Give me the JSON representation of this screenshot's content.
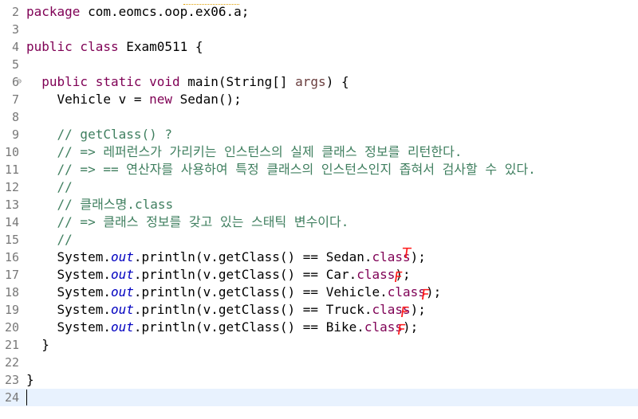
{
  "editor": {
    "lines": [
      {
        "num": "2",
        "tokens": [
          {
            "t": "package",
            "c": "kw"
          },
          {
            "t": " com.eomcs.oop.ex06.a;",
            "c": ""
          }
        ]
      },
      {
        "num": "3",
        "tokens": []
      },
      {
        "num": "4",
        "tokens": [
          {
            "t": "public class",
            "c": "kw"
          },
          {
            "t": " Exam0511 {",
            "c": ""
          }
        ]
      },
      {
        "num": "5",
        "tokens": []
      },
      {
        "num": "6",
        "fold": "⊖",
        "tokens": [
          {
            "t": "  public static void",
            "c": "kw"
          },
          {
            "t": " main(String[] ",
            "c": ""
          },
          {
            "t": "args",
            "c": "param"
          },
          {
            "t": ") {",
            "c": ""
          }
        ]
      },
      {
        "num": "7",
        "tokens": [
          {
            "t": "    Vehicle v = ",
            "c": ""
          },
          {
            "t": "new",
            "c": "kw"
          },
          {
            "t": " Sedan();",
            "c": ""
          }
        ]
      },
      {
        "num": "8",
        "tokens": []
      },
      {
        "num": "9",
        "tokens": [
          {
            "t": "    // getClass() ?",
            "c": "cm"
          }
        ]
      },
      {
        "num": "10",
        "tokens": [
          {
            "t": "    // => 레퍼런스가 가리키는 인스턴스의 실제 클래스 정보를 리턴한다.",
            "c": "cm"
          }
        ]
      },
      {
        "num": "11",
        "tokens": [
          {
            "t": "    // => == 연산자를 사용하여 특정 클래스의 인스턴스인지 좁혀서 검사할 수 있다.",
            "c": "cm"
          }
        ]
      },
      {
        "num": "12",
        "tokens": [
          {
            "t": "    //",
            "c": "cm"
          }
        ]
      },
      {
        "num": "13",
        "tokens": [
          {
            "t": "    // 클래스명.class",
            "c": "cm"
          }
        ]
      },
      {
        "num": "14",
        "tokens": [
          {
            "t": "    // => 클래스 정보를 갖고 있는 스태틱 변수이다.",
            "c": "cm"
          }
        ]
      },
      {
        "num": "15",
        "tokens": [
          {
            "t": "    //",
            "c": "cm"
          }
        ]
      },
      {
        "num": "16",
        "tokens": [
          {
            "t": "    System.",
            "c": ""
          },
          {
            "t": "out",
            "c": "fld"
          },
          {
            "t": ".println(v.getClass() == Sedan.",
            "c": ""
          },
          {
            "t": "class",
            "c": "kw"
          },
          {
            "t": ");",
            "c": ""
          }
        ]
      },
      {
        "num": "17",
        "tokens": [
          {
            "t": "    System.",
            "c": ""
          },
          {
            "t": "out",
            "c": "fld"
          },
          {
            "t": ".println(v.getClass() == Car.",
            "c": ""
          },
          {
            "t": "class",
            "c": "kw"
          },
          {
            "t": ");",
            "c": ""
          }
        ]
      },
      {
        "num": "18",
        "tokens": [
          {
            "t": "    System.",
            "c": ""
          },
          {
            "t": "out",
            "c": "fld"
          },
          {
            "t": ".println(v.getClass() == Vehicle.",
            "c": ""
          },
          {
            "t": "class",
            "c": "kw"
          },
          {
            "t": ");",
            "c": ""
          }
        ]
      },
      {
        "num": "19",
        "tokens": [
          {
            "t": "    System.",
            "c": ""
          },
          {
            "t": "out",
            "c": "fld"
          },
          {
            "t": ".println(v.getClass() == Truck.",
            "c": ""
          },
          {
            "t": "class",
            "c": "kw"
          },
          {
            "t": ");",
            "c": ""
          }
        ]
      },
      {
        "num": "20",
        "tokens": [
          {
            "t": "    System.",
            "c": ""
          },
          {
            "t": "out",
            "c": "fld"
          },
          {
            "t": ".println(v.getClass() == Bike.",
            "c": ""
          },
          {
            "t": "class",
            "c": "kw"
          },
          {
            "t": ");",
            "c": ""
          }
        ]
      },
      {
        "num": "21",
        "tokens": [
          {
            "t": "  }",
            "c": ""
          }
        ]
      },
      {
        "num": "22",
        "tokens": []
      },
      {
        "num": "23",
        "tokens": [
          {
            "t": "}",
            "c": ""
          }
        ]
      },
      {
        "num": "24",
        "current": true,
        "tokens": []
      }
    ],
    "annotations": [
      "T",
      "F",
      "F",
      "F",
      "F"
    ],
    "colors": {
      "keyword": "#7f0055",
      "comment": "#3f7f5f",
      "static_field": "#0000c0",
      "parameter": "#6a3e3e",
      "annotation": "#ff1a1a",
      "current_line": "#e8f2fe"
    }
  }
}
